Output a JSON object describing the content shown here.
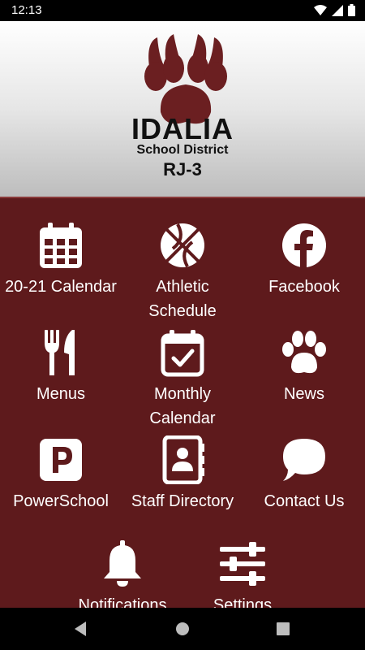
{
  "status": {
    "time": "12:13"
  },
  "header": {
    "title": "IDALIA",
    "subtitle": "School District",
    "district_code": "RJ-3"
  },
  "tiles": [
    {
      "label": "20-21 Calendar",
      "icon": "calendar-grid-icon"
    },
    {
      "label": "Athletic Schedule",
      "icon": "basketball-icon"
    },
    {
      "label": "Facebook",
      "icon": "facebook-icon"
    },
    {
      "label": "Menus",
      "icon": "utensils-icon"
    },
    {
      "label": "Monthly Calendar",
      "icon": "calendar-check-icon"
    },
    {
      "label": "News",
      "icon": "paw-icon"
    },
    {
      "label": "PowerSchool",
      "icon": "powerschool-icon"
    },
    {
      "label": "Staff Directory",
      "icon": "address-book-icon"
    },
    {
      "label": "Contact Us",
      "icon": "chat-bubble-icon"
    },
    {
      "label": "Notifications",
      "icon": "bell-icon"
    },
    {
      "label": "Settings",
      "icon": "sliders-icon"
    }
  ],
  "colors": {
    "brand_maroon": "#5e1a1c",
    "logo_maroon": "#6b1f21",
    "header_top": "#ffffff",
    "header_bottom": "#bdbdbd"
  },
  "nav": {
    "back": "back-icon",
    "home": "home-icon",
    "recents": "recents-icon"
  }
}
